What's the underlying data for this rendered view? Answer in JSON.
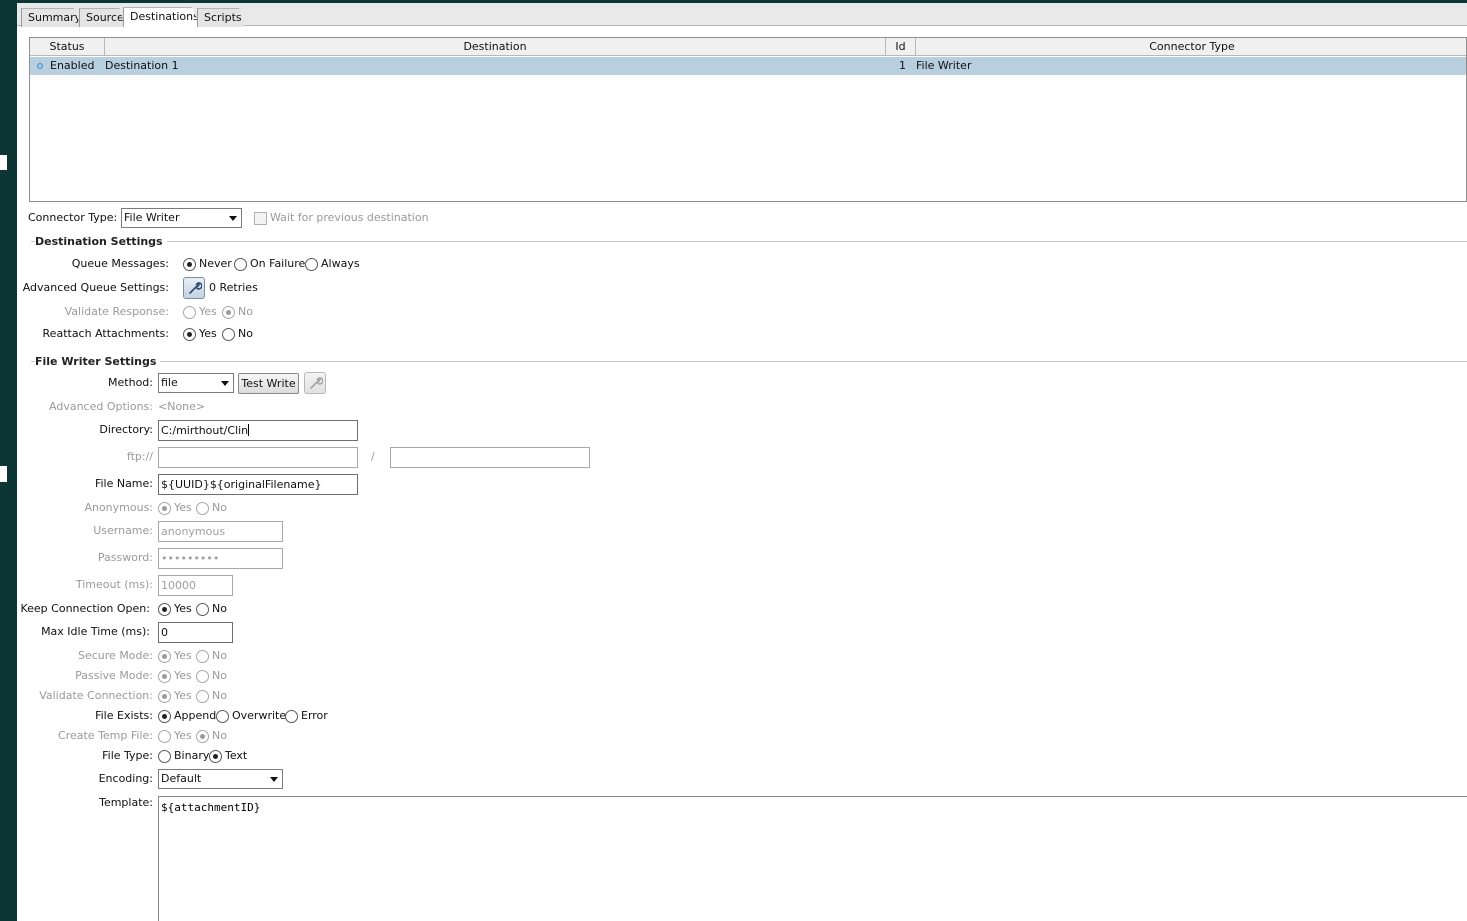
{
  "tabs": [
    {
      "label": "Summary"
    },
    {
      "label": "Source"
    },
    {
      "label": "Destinations"
    },
    {
      "label": "Scripts"
    }
  ],
  "table": {
    "headers": [
      "Status",
      "Destination",
      "Id",
      "Connector Type"
    ],
    "rows": [
      {
        "status": "Enabled",
        "destination": "Destination 1",
        "id": "1",
        "connector_type": "File Writer"
      }
    ]
  },
  "connector": {
    "label": "Connector Type:",
    "value": "File Writer",
    "wait_label": "Wait for previous destination"
  },
  "destination_settings": {
    "title": "Destination Settings",
    "queue_messages": {
      "label": "Queue Messages:",
      "options": [
        "Never",
        "On Failure",
        "Always"
      ],
      "selected": "Never"
    },
    "advanced_queue": {
      "label": "Advanced Queue Settings:",
      "summary": "0 Retries"
    },
    "validate_response": {
      "label": "Validate Response:",
      "options": [
        "Yes",
        "No"
      ],
      "selected": "No"
    },
    "reattach": {
      "label": "Reattach Attachments:",
      "options": [
        "Yes",
        "No"
      ],
      "selected": "Yes"
    }
  },
  "file_writer": {
    "title": "File Writer Settings",
    "method": {
      "label": "Method:",
      "value": "file",
      "test_write": "Test Write"
    },
    "advanced_options": {
      "label": "Advanced Options:",
      "value": "<None>"
    },
    "directory": {
      "label": "Directory:",
      "value": "C:/mirthout/Clin"
    },
    "ftp": {
      "label": "ftp://",
      "separator": "/"
    },
    "file_name": {
      "label": "File Name:",
      "value": "${UUID}${originalFilename}"
    },
    "anonymous": {
      "label": "Anonymous:",
      "options": [
        "Yes",
        "No"
      ],
      "selected": "Yes"
    },
    "username": {
      "label": "Username:",
      "value": "anonymous"
    },
    "password": {
      "label": "Password:",
      "value": "•••••••••"
    },
    "timeout": {
      "label": "Timeout (ms):",
      "value": "10000"
    },
    "keep_open": {
      "label": "Keep Connection Open:",
      "options": [
        "Yes",
        "No"
      ],
      "selected": "Yes"
    },
    "max_idle": {
      "label": "Max Idle Time (ms):",
      "value": "0"
    },
    "secure_mode": {
      "label": "Secure Mode:",
      "options": [
        "Yes",
        "No"
      ],
      "selected": "Yes"
    },
    "passive_mode": {
      "label": "Passive Mode:",
      "options": [
        "Yes",
        "No"
      ],
      "selected": "Yes"
    },
    "validate_connection": {
      "label": "Validate Connection:",
      "options": [
        "Yes",
        "No"
      ],
      "selected": "Yes"
    },
    "file_exists": {
      "label": "File Exists:",
      "options": [
        "Append",
        "Overwrite",
        "Error"
      ],
      "selected": "Append"
    },
    "create_temp": {
      "label": "Create Temp File:",
      "options": [
        "Yes",
        "No"
      ],
      "selected": "No"
    },
    "file_type": {
      "label": "File Type:",
      "options": [
        "Binary",
        "Text"
      ],
      "selected": "Text"
    },
    "encoding": {
      "label": "Encoding:",
      "value": "Default"
    },
    "template": {
      "label": "Template:",
      "value": "${attachmentID}"
    }
  }
}
